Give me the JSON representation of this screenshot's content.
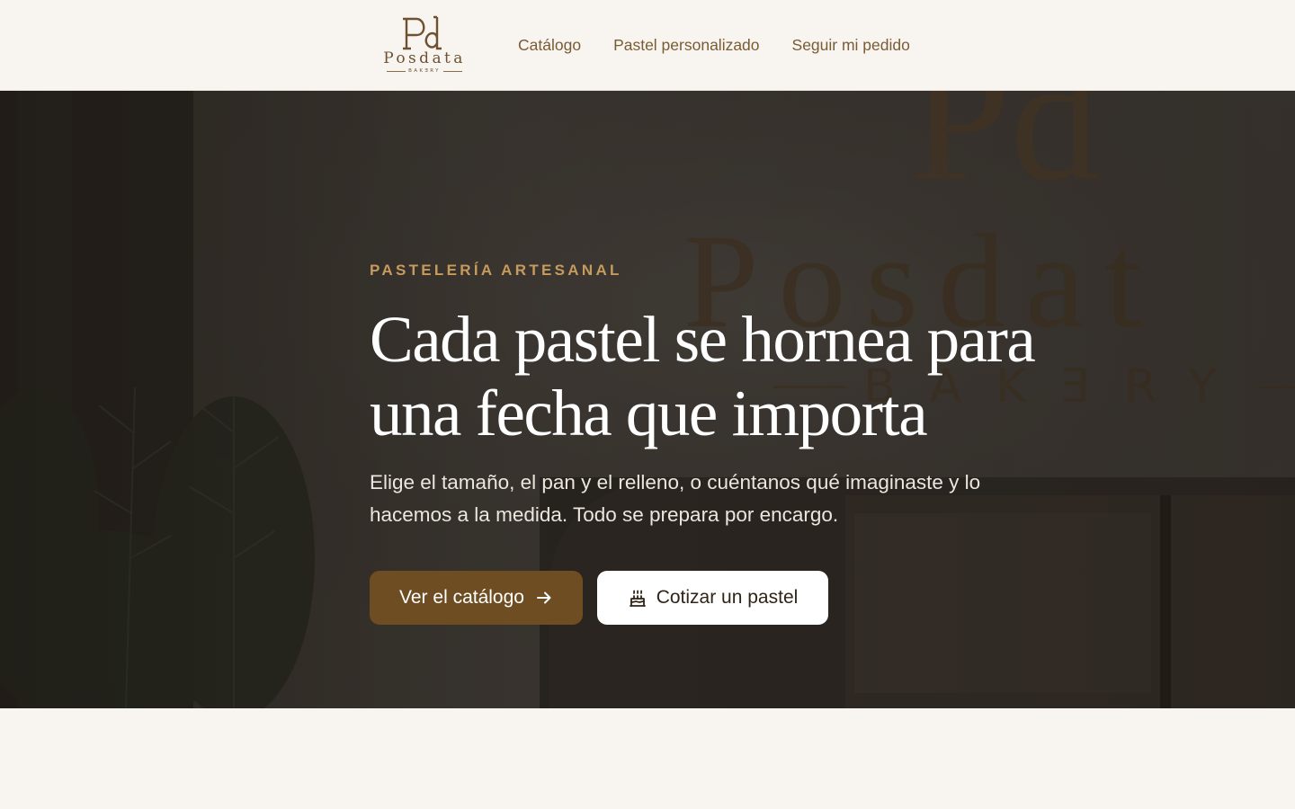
{
  "header": {
    "logo": {
      "monogram": "Pd",
      "wordmark": "Posdata",
      "sub": "BAKƎRY",
      "icon": "pd-monogram-logo"
    },
    "nav": [
      {
        "label": "Catálogo"
      },
      {
        "label": "Pastel personalizado"
      },
      {
        "label": "Seguir mi pedido"
      }
    ]
  },
  "hero": {
    "background_sign": {
      "monogram": "Pd",
      "wordmark": "Posdat",
      "sub": "BAKƎRY"
    },
    "eyebrow": "PASTELERÍA ARTESANAL",
    "title_line1": "Cada pastel se hornea para",
    "title_line2": "una fecha que importa",
    "lead": "Elige el tamaño, el pan y el relleno, o cuéntanos qué imaginaste y lo hacemos a la medida. Todo se prepara por encargo.",
    "primary_button": {
      "label": "Ver el catálogo",
      "icon": "arrow-right-icon"
    },
    "secondary_button": {
      "label": "Cotizar un pastel",
      "icon": "cake-icon"
    }
  },
  "colors": {
    "page_bg": "#f8f5f1",
    "accent_gold": "#c79a5e",
    "brand_brown": "#6f4d22",
    "nav_text": "#7a5c33"
  }
}
